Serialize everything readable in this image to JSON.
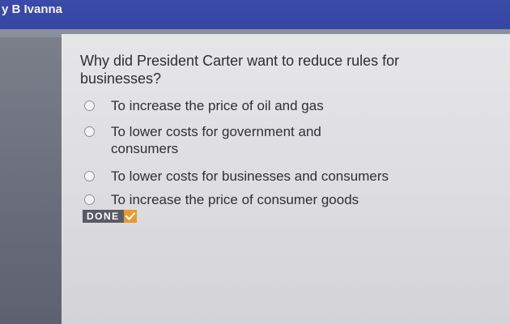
{
  "header": {
    "user_name": "y B Ivanna"
  },
  "question": {
    "text": "Why did President Carter want to reduce rules for businesses?",
    "options": [
      {
        "label": "To increase the price of oil and gas",
        "selected": false
      },
      {
        "label": "To lower costs for government and consumers",
        "selected": false
      },
      {
        "label": "To lower costs for businesses and consumers",
        "selected": false
      },
      {
        "label": "To increase the price of consumer goods",
        "selected": false
      }
    ]
  },
  "done_badge": {
    "label": "DONE",
    "icon": "check-icon",
    "accent": "#e79a2b"
  }
}
